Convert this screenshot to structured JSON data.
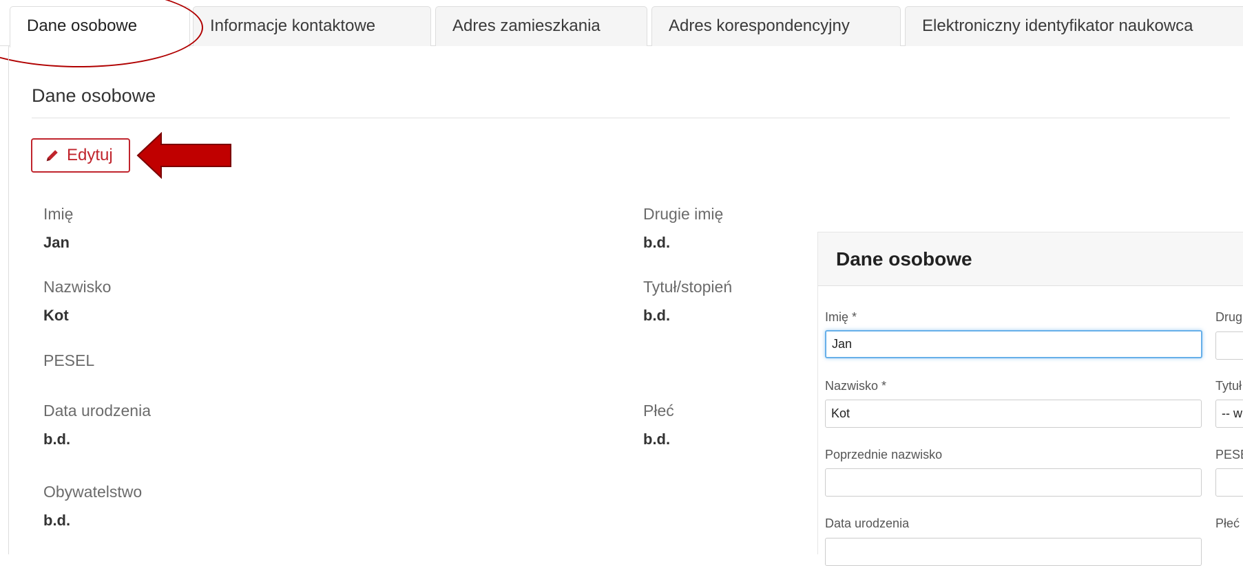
{
  "tabs": [
    {
      "label": "Dane osobowe",
      "active": true
    },
    {
      "label": "Informacje kontaktowe"
    },
    {
      "label": "Adres zamieszkania"
    },
    {
      "label": "Adres korespondencyjny"
    },
    {
      "label": "Elektroniczny identyfikator naukowca"
    }
  ],
  "section": {
    "title": "Dane osobowe",
    "edit_button": "Edytuj"
  },
  "fields": {
    "imie": {
      "label": "Imię",
      "value": "Jan"
    },
    "drugie_imie": {
      "label": "Drugie imię",
      "value": "b.d."
    },
    "nazwisko": {
      "label": "Nazwisko",
      "value": "Kot"
    },
    "tytul": {
      "label": "Tytuł/stopień",
      "value": "b.d."
    },
    "pesel": {
      "label": "PESEL"
    },
    "data_urodzenia": {
      "label": "Data urodzenia",
      "value": "b.d."
    },
    "plec": {
      "label": "Płeć",
      "value": "b.d."
    },
    "obywatelstwo": {
      "label": "Obywatelstwo",
      "value": "b.d."
    }
  },
  "edit_form": {
    "title": "Dane osobowe",
    "imie_label": "Imię *",
    "imie_value": "Jan",
    "drugie_label": "Drug",
    "nazwisko_label": "Nazwisko *",
    "nazwisko_value": "Kot",
    "tytul_label": "Tytuł",
    "tytul_value": "-- w",
    "poprzednie_label": "Poprzednie nazwisko",
    "poprzednie_value": "",
    "pesel_label": "PESEL",
    "data_label": "Data urodzenia",
    "plec_label": "Płeć"
  },
  "colors": {
    "accent_red": "#c0242c",
    "annotation_red": "#b00000",
    "focus_blue": "#66afe9"
  }
}
